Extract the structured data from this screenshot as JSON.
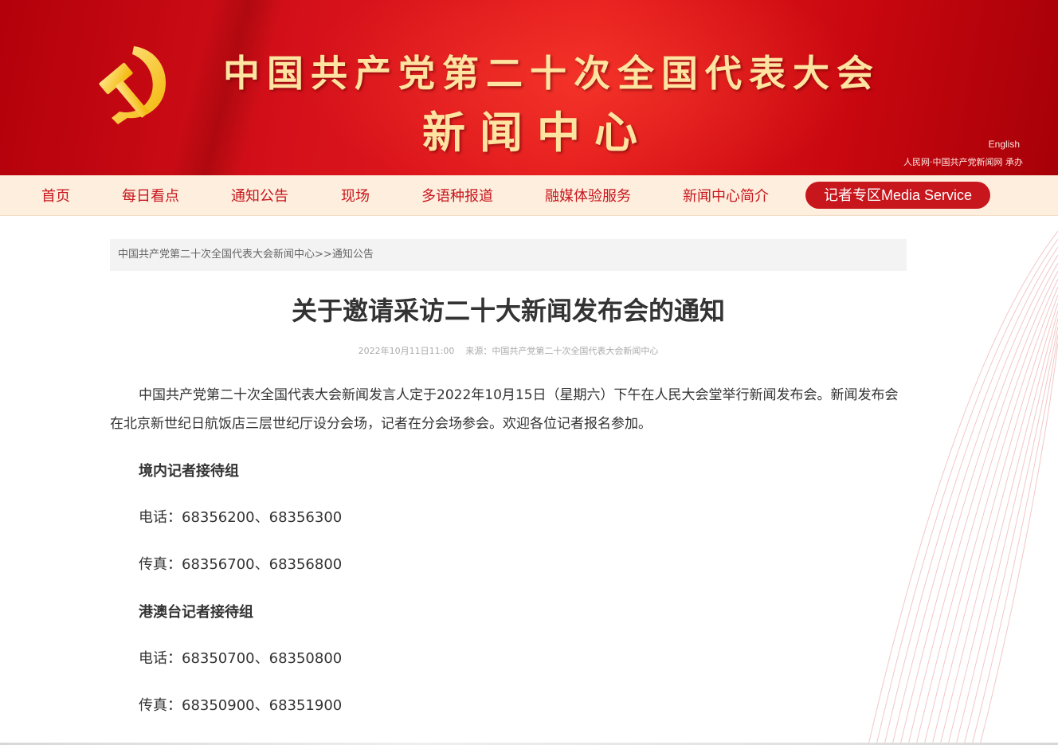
{
  "header": {
    "title": "中国共产党第二十次全国代表大会",
    "subtitle": "新闻中心",
    "english_link": "English",
    "host_text": "人民网·中国共产党新闻网 承办",
    "emblem_icon": "hammer-and-sickle-icon"
  },
  "nav": {
    "items": [
      "首页",
      "每日看点",
      "通知公告",
      "现场",
      "多语种报道",
      "融媒体验服务",
      "新闻中心简介"
    ],
    "media_service": "记者专区Media Service"
  },
  "breadcrumb": {
    "home": "中国共产党第二十次全国代表大会新闻中心",
    "separator": ">>",
    "current": "通知公告"
  },
  "article": {
    "title": "关于邀请采访二十大新闻发布会的通知",
    "datetime": "2022年10月11日11:00",
    "source": "来源：中国共产党第二十次全国代表大会新闻中心",
    "intro": "中国共产党第二十次全国代表大会新闻发言人定于2022年10月15日（星期六）下午在人民大会堂举行新闻发布会。新闻发布会在北京新世纪日航饭店三层世纪厅设分会场，记者在分会场参会。欢迎各位记者报名参加。",
    "groups": [
      {
        "heading": "境内记者接待组",
        "phone": "电话：68356200、68356300",
        "fax": "传真：68356700、68356800"
      },
      {
        "heading": "港澳台记者接待组",
        "phone": "电话：68350700、68350800",
        "fax": "传真：68350900、68351900"
      }
    ]
  },
  "colors": {
    "banner_red": "#d4101a",
    "gold_text": "#ffe3a1",
    "nav_background": "#fdeedd",
    "accent_red": "#c8161d",
    "body_text": "#333333"
  }
}
